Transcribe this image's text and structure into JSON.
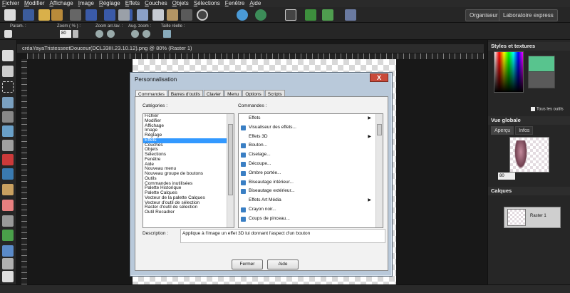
{
  "menu": [
    "Fichier",
    "Modifier",
    "Affichage",
    "Image",
    "Réglage",
    "Effets",
    "Couches",
    "Objets",
    "Sélections",
    "Fenêtre",
    "Aide"
  ],
  "toolbar": {
    "organiser": "Organiseur",
    "laboratoire": "Laboratoire express",
    "icons": [
      "new-icon",
      "save-icon",
      "open-icon",
      "browse-icon",
      "camera-icon",
      "jpeg-icon",
      "gif-icon",
      "png-icon",
      "scan-icon",
      "print-icon",
      "cut-icon",
      "copy-icon",
      "paste-icon",
      "crop-icon",
      "rotate-icon",
      "undo-icon",
      "redo-icon",
      "settings-icon",
      "script-run-icon",
      "script-record-icon",
      "workspace-icon"
    ]
  },
  "options": {
    "param_label": "Param. :",
    "zoom_label": "Zoom ( % ) :",
    "zoom_value": "80",
    "zoom_arr_label": "Zoom arr./av. :",
    "aug_label": "Aug. zoom :",
    "taille_label": "Taille réelle :"
  },
  "document": {
    "title": "créaYayaTristesseetDouceur(DCL33III.23.10.12).png @  80% (Raster 1)"
  },
  "right": {
    "styles_title": "Styles et textures",
    "tous_outils": "Tous les outils",
    "vue_title": "Vue globale",
    "tab_apercu": "Aperçu",
    "tab_infos": "Infos",
    "zoom_value": "80",
    "calques_title": "Calques",
    "layer_name": "Raster 1"
  },
  "dialog": {
    "title": "Personnalisation",
    "close": "X",
    "tabs": [
      "Commandes",
      "Barres d'outils",
      "Clavier",
      "Menu",
      "Options",
      "Scripts"
    ],
    "categories_label": "Catégories :",
    "commands_label": "Commandes :",
    "categories": [
      "Fichier",
      "Modifier",
      "Affichage",
      "Image",
      "Réglage",
      "Effets",
      "Couches",
      "Objets",
      "Sélections",
      "Fenêtre",
      "Aide",
      "Nouveau menu",
      "Nouveau groupe de boutons",
      "Outils",
      "Commandes inutilisées",
      "Palette Historique",
      "Palette Calques",
      "Vecteur de la palette Calques",
      "Vecteur d'outil de sélection",
      "Raster d'outil de sélection",
      "Outil Recadrer"
    ],
    "selected_category": "Effets",
    "commands": [
      {
        "label": "Effets",
        "icon": "",
        "arrow": true
      },
      {
        "label": "Visualiseur des effets...",
        "icon": "effects-browser-icon",
        "arrow": false
      },
      {
        "label": "Effets 3D",
        "icon": "",
        "arrow": true
      },
      {
        "label": "Bouton...",
        "icon": "button-effect-icon",
        "arrow": false
      },
      {
        "label": "Ciselage...",
        "icon": "chisel-icon",
        "arrow": false
      },
      {
        "label": "Découpe...",
        "icon": "cutout-icon",
        "arrow": false
      },
      {
        "label": "Ombre portée...",
        "icon": "drop-shadow-icon",
        "arrow": false
      },
      {
        "label": "Biseautage intérieur...",
        "icon": "inner-bevel-icon",
        "arrow": false
      },
      {
        "label": "Biseautage extérieur...",
        "icon": "outer-bevel-icon",
        "arrow": false
      },
      {
        "label": "Effets Art Média",
        "icon": "",
        "arrow": true
      },
      {
        "label": "Crayon noir...",
        "icon": "black-pencil-icon",
        "arrow": false
      },
      {
        "label": "Coups de pinceau...",
        "icon": "brush-strokes-icon",
        "arrow": false
      }
    ],
    "description_label": "Description :",
    "description": "Applique à l'image un effet 3D lui donnant l'aspect d'un bouton",
    "btn_close": "Fermer",
    "btn_help": "Aide"
  }
}
